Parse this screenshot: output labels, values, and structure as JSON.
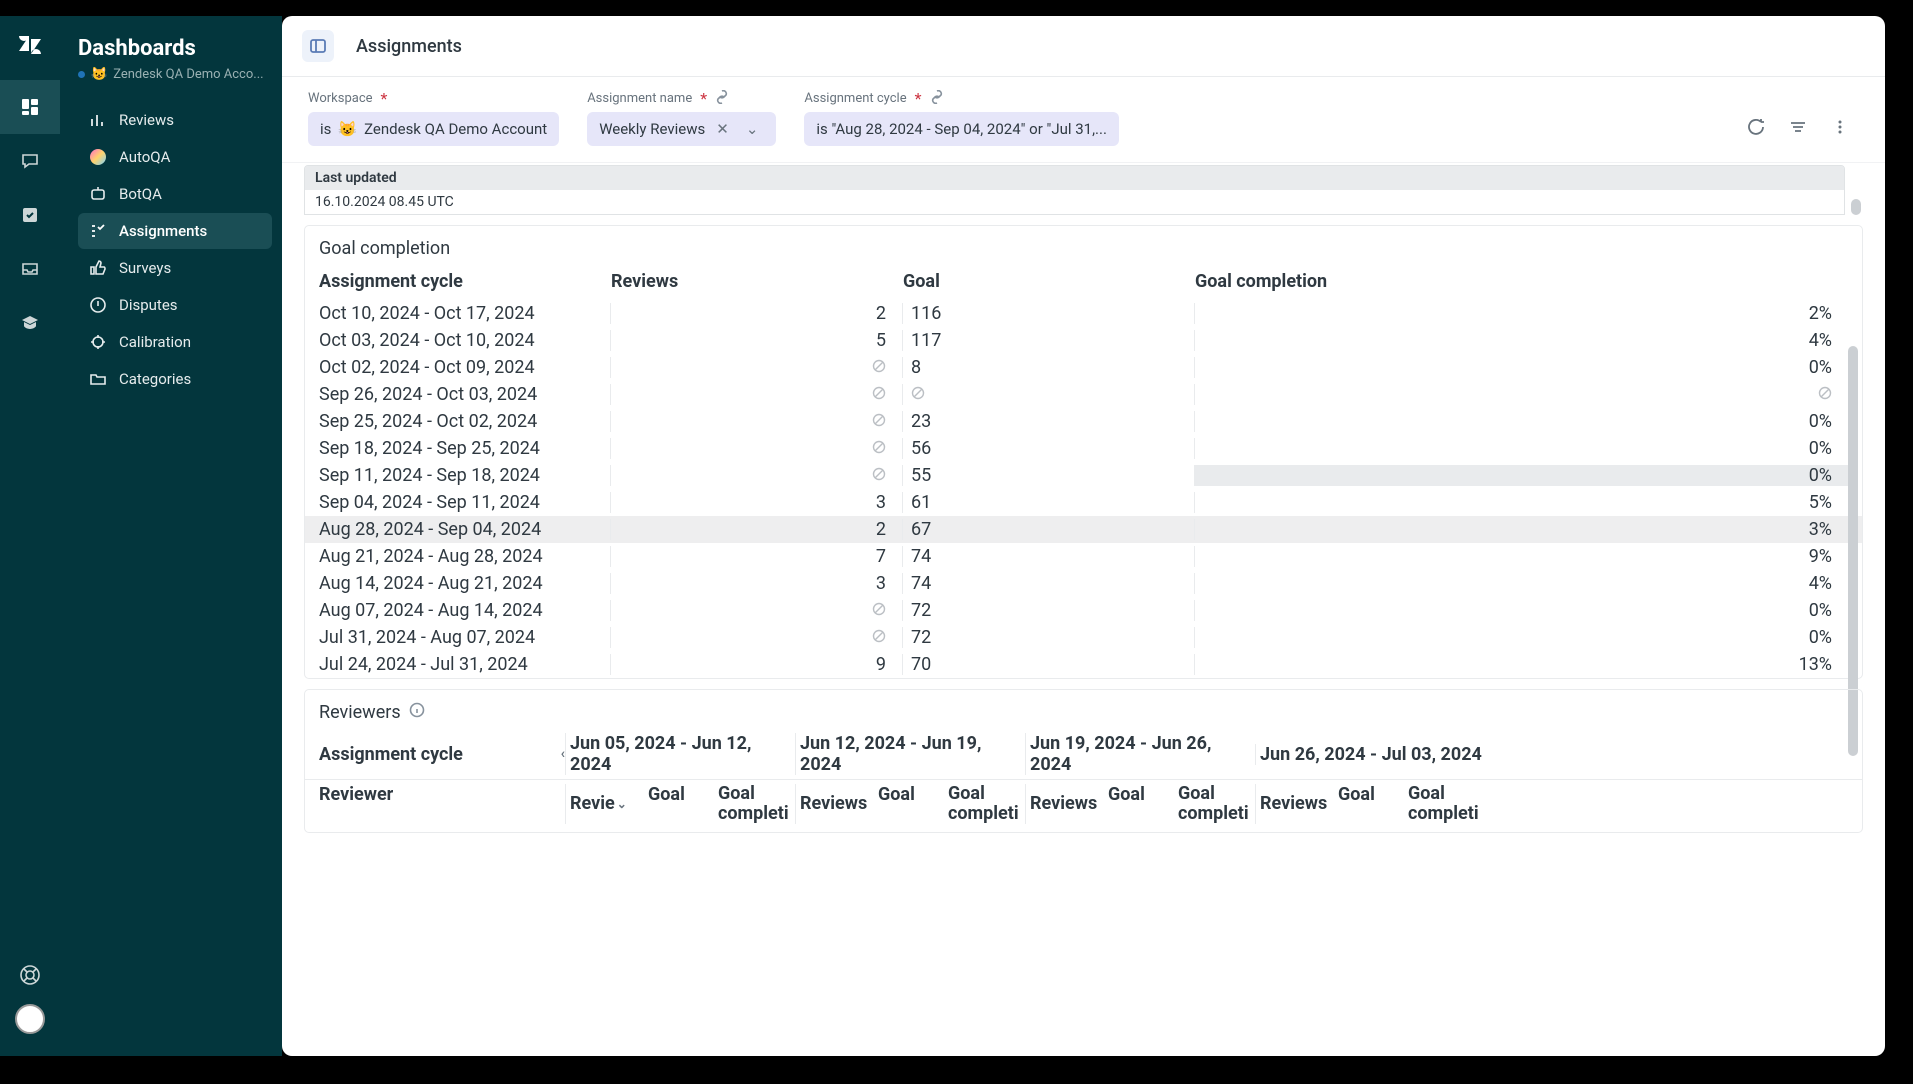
{
  "side": {
    "title": "Dashboards",
    "account_emoji": "😺",
    "account": "Zendesk QA Demo Acco...",
    "nav": [
      "Reviews",
      "AutoQA",
      "BotQA",
      "Assignments",
      "Surveys",
      "Disputes",
      "Calibration",
      "Categories"
    ]
  },
  "header": {
    "title": "Assignments"
  },
  "filters": {
    "workspace_label": "Workspace",
    "workspace_chip_prefix": "is",
    "workspace_emoji": "😺",
    "workspace_chip": "Zendesk QA Demo Account",
    "assignment_label": "Assignment name",
    "assignment_chip": "Weekly Reviews",
    "cycle_label": "Assignment cycle",
    "cycle_chip": "is \"Aug 28, 2024 - Sep 04, 2024\" or \"Jul 31,..."
  },
  "lastUpdated": {
    "label": "Last updated",
    "value": "16.10.2024 08.45 UTC"
  },
  "goalSection": {
    "title": "Goal completion",
    "headers": {
      "cycle": "Assignment cycle",
      "reviews": "Reviews",
      "goal": "Goal",
      "completion": "Goal completion"
    },
    "rows": [
      {
        "cycle": "Oct 10, 2024 - Oct 17, 2024",
        "reviews": "2",
        "goal": "116",
        "comp": "2%"
      },
      {
        "cycle": "Oct 03, 2024 - Oct 10, 2024",
        "reviews": "5",
        "goal": "117",
        "comp": "4%"
      },
      {
        "cycle": "Oct 02, 2024 - Oct 09, 2024",
        "reviews": null,
        "goal": "8",
        "comp": "0%"
      },
      {
        "cycle": "Sep 26, 2024 - Oct 03, 2024",
        "reviews": null,
        "goal": null,
        "comp": null
      },
      {
        "cycle": "Sep 25, 2024 - Oct 02, 2024",
        "reviews": null,
        "goal": "23",
        "comp": "0%"
      },
      {
        "cycle": "Sep 18, 2024 - Sep 25, 2024",
        "reviews": null,
        "goal": "56",
        "comp": "0%"
      },
      {
        "cycle": "Sep 11, 2024 - Sep 18, 2024",
        "reviews": null,
        "goal": "55",
        "comp": "0%",
        "compHi": true
      },
      {
        "cycle": "Sep 04, 2024 - Sep 11, 2024",
        "reviews": "3",
        "goal": "61",
        "comp": "5%"
      },
      {
        "cycle": "Aug 28, 2024 - Sep 04, 2024",
        "reviews": "2",
        "goal": "67",
        "comp": "3%",
        "hi": true
      },
      {
        "cycle": "Aug 21, 2024 - Aug 28, 2024",
        "reviews": "7",
        "goal": "74",
        "comp": "9%"
      },
      {
        "cycle": "Aug 14, 2024 - Aug 21, 2024",
        "reviews": "3",
        "goal": "74",
        "comp": "4%"
      },
      {
        "cycle": "Aug 07, 2024 - Aug 14, 2024",
        "reviews": null,
        "goal": "72",
        "comp": "0%"
      },
      {
        "cycle": "Jul 31, 2024 - Aug 07, 2024",
        "reviews": null,
        "goal": "72",
        "comp": "0%"
      },
      {
        "cycle": "Jul 24, 2024 - Jul 31, 2024",
        "reviews": "9",
        "goal": "70",
        "comp": "13%"
      }
    ]
  },
  "reviewers": {
    "title": "Reviewers",
    "cycle_header": "Assignment cycle",
    "cycles": [
      "Jun 05, 2024 - Jun 12, 2024",
      "Jun 12, 2024 - Jun 19, 2024",
      "Jun 19, 2024 - Jun 26, 2024",
      "Jun 26, 2024 - Jul 03, 2024"
    ],
    "sub": {
      "reviewer": "Reviewer",
      "revie": "Revie",
      "reviews": "Reviews",
      "goal": "Goal",
      "comp1": "Goal",
      "comp2": "completi"
    }
  }
}
